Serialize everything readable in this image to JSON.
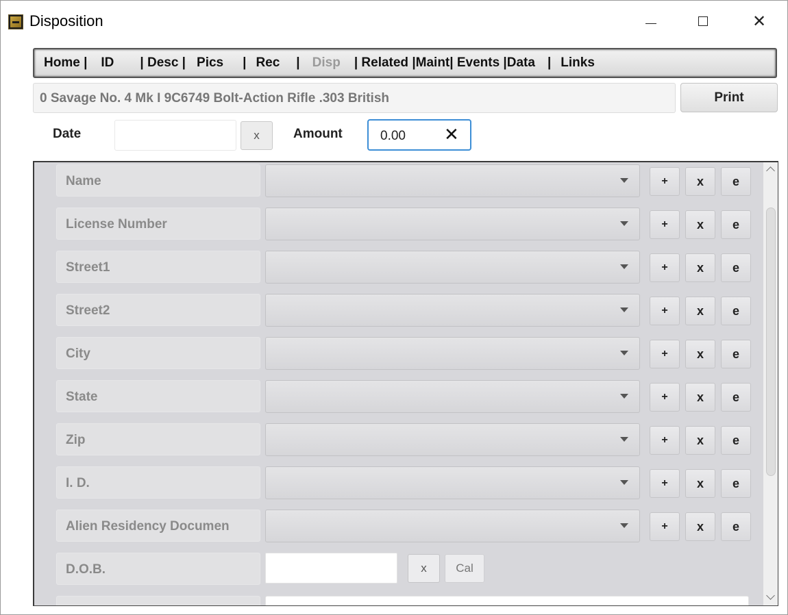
{
  "window": {
    "title": "Disposition",
    "close_glyph": "✕"
  },
  "nav": {
    "items": [
      {
        "label": "Home |",
        "disabled": false
      },
      {
        "label": "ID",
        "disabled": false
      },
      {
        "label": "| Desc |",
        "disabled": false
      },
      {
        "label": "Pics",
        "disabled": false
      },
      {
        "label": "|",
        "disabled": false
      },
      {
        "label": "Rec",
        "disabled": false
      },
      {
        "label": "|",
        "disabled": false
      },
      {
        "label": "Disp",
        "disabled": true
      },
      {
        "label": "| Related |",
        "disabled": false
      },
      {
        "label": "Maint",
        "disabled": false
      },
      {
        "label": "| Events |",
        "disabled": false
      },
      {
        "label": "Data",
        "disabled": false
      },
      {
        "label": "|",
        "disabled": false
      },
      {
        "label": "Links",
        "disabled": false
      }
    ]
  },
  "record": {
    "title": "0 Savage  No. 4 Mk I 9C6749 Bolt-Action Rifle .303 British",
    "print_label": "Print"
  },
  "header_fields": {
    "date_label": "Date",
    "date_value": "",
    "date_clear": "x",
    "amount_label": "Amount",
    "amount_value": "0.00",
    "amount_clear": "✕"
  },
  "form": {
    "combo_rows": [
      {
        "label": "Name"
      },
      {
        "label": "License Number"
      },
      {
        "label": "Street1"
      },
      {
        "label": "Street2"
      },
      {
        "label": "City"
      },
      {
        "label": "State"
      },
      {
        "label": "Zip"
      },
      {
        "label": "I. D."
      },
      {
        "label": "Alien Residency Documen"
      }
    ],
    "buttons": {
      "add": "+",
      "remove": "x",
      "edit": "e"
    },
    "dob": {
      "label": "D.O.B.",
      "value": "",
      "clear": "x",
      "cal": "Cal"
    }
  },
  "colors": {
    "focus_border": "#3d8ed6",
    "panel_bg": "#d7d7db",
    "label_text": "#8a8a8a"
  }
}
